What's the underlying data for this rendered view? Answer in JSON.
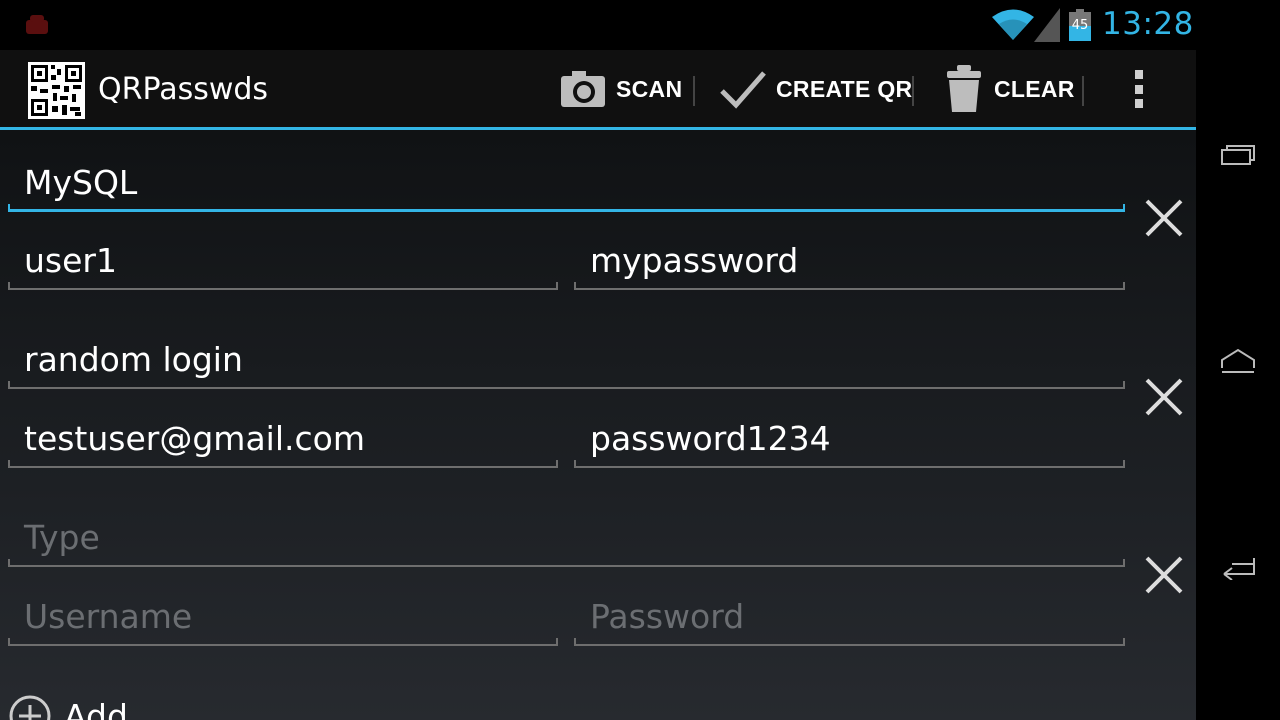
{
  "status_bar": {
    "time": "13:28",
    "battery_level": "45",
    "icons": [
      "android-notification-icon",
      "wifi-icon",
      "signal-icon",
      "battery-icon"
    ]
  },
  "action_bar": {
    "title": "QRPasswds",
    "actions": [
      {
        "label": "SCAN",
        "icon": "camera-icon"
      },
      {
        "label": "CREATE QR",
        "icon": "checkmark-icon"
      },
      {
        "label": "CLEAR",
        "icon": "trash-icon"
      }
    ],
    "overflow_icon": "overflow-menu-icon",
    "accent_color": "#33b5e5"
  },
  "entries": [
    {
      "type": "MySQL",
      "username": "user1",
      "password": "mypassword"
    },
    {
      "type": "random login",
      "username": "testuser@gmail.com",
      "password": "password1234"
    },
    {
      "type": "",
      "username": "",
      "password": "",
      "placeholders": {
        "type": "Type",
        "username": "Username",
        "password": "Password"
      }
    }
  ],
  "add_button": {
    "label": "Add",
    "icon": "add-circle-icon"
  },
  "nav_bar": {
    "icons": [
      "recent-apps-icon",
      "home-icon",
      "back-icon"
    ]
  }
}
